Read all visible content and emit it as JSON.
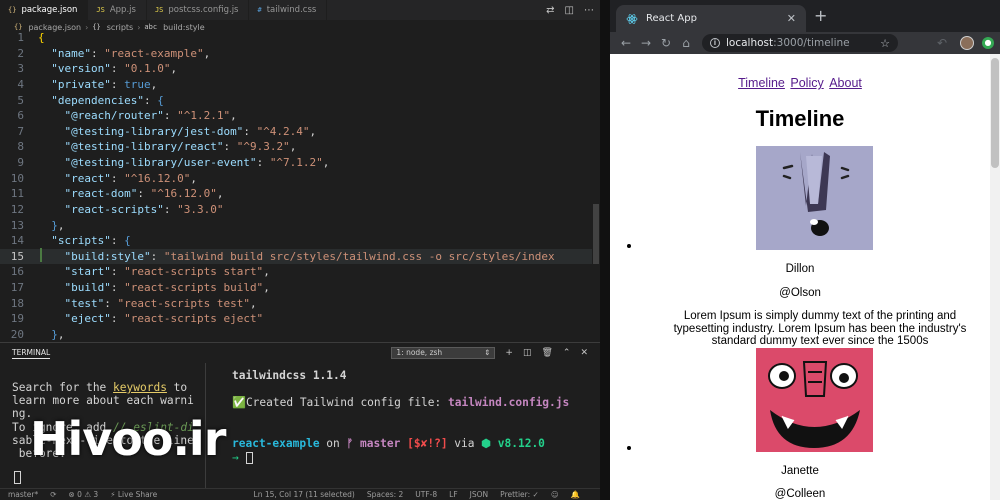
{
  "editor": {
    "tabs": [
      {
        "glyph": "{}",
        "label": "package.json",
        "active": true
      },
      {
        "glyph": "JS",
        "label": "App.js",
        "active": false
      },
      {
        "glyph": "JS",
        "label": "postcss.config.js",
        "active": false
      },
      {
        "glyph": "#",
        "label": "tailwind.css",
        "active": false
      }
    ],
    "breadcrumb": [
      "package.json",
      "scripts",
      "build:style"
    ],
    "code_lines": [
      {
        "n": "1",
        "html": "<span class='p'>{</span>"
      },
      {
        "n": "2",
        "html": "  <span class='k'>\"name\"</span><span class='o'>: </span><span class='s'>\"react-example\"</span><span class='o'>,</span>"
      },
      {
        "n": "3",
        "html": "  <span class='k'>\"version\"</span><span class='o'>: </span><span class='s'>\"0.1.0\"</span><span class='o'>,</span>"
      },
      {
        "n": "4",
        "html": "  <span class='k'>\"private\"</span><span class='o'>: </span><span class='kw'>true</span><span class='o'>,</span>"
      },
      {
        "n": "5",
        "html": "  <span class='k'>\"dependencies\"</span><span class='o'>: </span><span class='kw'>{</span>"
      },
      {
        "n": "6",
        "html": "    <span class='k'>\"@reach/router\"</span><span class='o'>: </span><span class='s'>\"^1.2.1\"</span><span class='o'>,</span>"
      },
      {
        "n": "7",
        "html": "    <span class='k'>\"@testing-library/jest-dom\"</span><span class='o'>: </span><span class='s'>\"^4.2.4\"</span><span class='o'>,</span>"
      },
      {
        "n": "8",
        "html": "    <span class='k'>\"@testing-library/react\"</span><span class='o'>: </span><span class='s'>\"^9.3.2\"</span><span class='o'>,</span>"
      },
      {
        "n": "9",
        "html": "    <span class='k'>\"@testing-library/user-event\"</span><span class='o'>: </span><span class='s'>\"^7.1.2\"</span><span class='o'>,</span>"
      },
      {
        "n": "10",
        "html": "    <span class='k'>\"react\"</span><span class='o'>: </span><span class='s'>\"^16.12.0\"</span><span class='o'>,</span>"
      },
      {
        "n": "11",
        "html": "    <span class='k'>\"react-dom\"</span><span class='o'>: </span><span class='s'>\"^16.12.0\"</span><span class='o'>,</span>"
      },
      {
        "n": "12",
        "html": "    <span class='k'>\"react-scripts\"</span><span class='o'>: </span><span class='s'>\"3.3.0\"</span>"
      },
      {
        "n": "13",
        "html": "  <span class='kw'>}</span><span class='o'>,</span>"
      },
      {
        "n": "14",
        "html": "  <span class='k'>\"scripts\"</span><span class='o'>: </span><span class='kw'>{</span>"
      },
      {
        "n": "15",
        "html": "    <span class='k'>\"build:style\"</span><span class='o'>: </span><span class='s'>\"tailwind build src/styles/tailwind.css -o src/styles/index</span>"
      },
      {
        "n": "16",
        "html": "    <span class='k'>\"start\"</span><span class='o'>: </span><span class='s'>\"react-scripts start\"</span><span class='o'>,</span>"
      },
      {
        "n": "17",
        "html": "    <span class='k'>\"build\"</span><span class='o'>: </span><span class='s'>\"react-scripts build\"</span><span class='o'>,</span>"
      },
      {
        "n": "18",
        "html": "    <span class='k'>\"test\"</span><span class='o'>: </span><span class='s'>\"react-scripts test\"</span><span class='o'>,</span>"
      },
      {
        "n": "19",
        "html": "    <span class='k'>\"eject\"</span><span class='o'>: </span><span class='s'>\"react-scripts eject\"</span>"
      },
      {
        "n": "20",
        "html": "  <span class='kw'>}</span><span class='o'>,</span>"
      }
    ],
    "current_line": "15"
  },
  "terminal": {
    "title": "TERMINAL",
    "shell_select": "1: node, zsh",
    "left_lines": [
      "Search for the <span class='t-kw'>keywords</span> to",
      "learn more about each warni",
      "ng.",
      "To ignore, add <span class='t-dim'>// eslint-di</span>",
      "sable-next-line to the line",
      " before."
    ],
    "right_output": {
      "version_line": "tailwindcss 1.1.4",
      "created_prefix": "Created Tailwind config file: ",
      "created_file": "tailwind.config.js",
      "prompt_project": "react-example",
      "prompt_on": " on ",
      "prompt_branch": "master",
      "prompt_git": "[$✘!?]",
      "prompt_via": " via ",
      "prompt_node": "v8.12.0",
      "prompt_arrow": "→"
    }
  },
  "statusbar": {
    "left": [
      "master*",
      "⟳",
      "⊗ 0 ⚠ 3",
      "⚡ Live Share"
    ],
    "right": [
      "Ln 15, Col 17 (11 selected)",
      "Spaces: 2",
      "UTF-8",
      "LF",
      "JSON",
      "Prettier: ✓",
      "☺",
      "🔔"
    ]
  },
  "watermark": "Hivoo.ir",
  "browser": {
    "tab_title": "React App",
    "url_host": "localhost",
    "url_path": ":3000/timeline",
    "nav": [
      "Timeline",
      "Policy",
      "About"
    ],
    "page_title": "Timeline",
    "posts": [
      {
        "name": "Dillon",
        "handle": "@Olson",
        "body": "Lorem Ipsum is simply dummy text of the printing and typesetting industry. Lorem Ipsum has been the industry's standard dummy text ever since the 1500s"
      },
      {
        "name": "Janette",
        "handle": "@Colleen"
      }
    ]
  },
  "colors": {
    "editor_bg": "#1e1e1e",
    "avatar_1_bg": "#a6a7c9",
    "avatar_2_bg": "#db4a6a"
  }
}
